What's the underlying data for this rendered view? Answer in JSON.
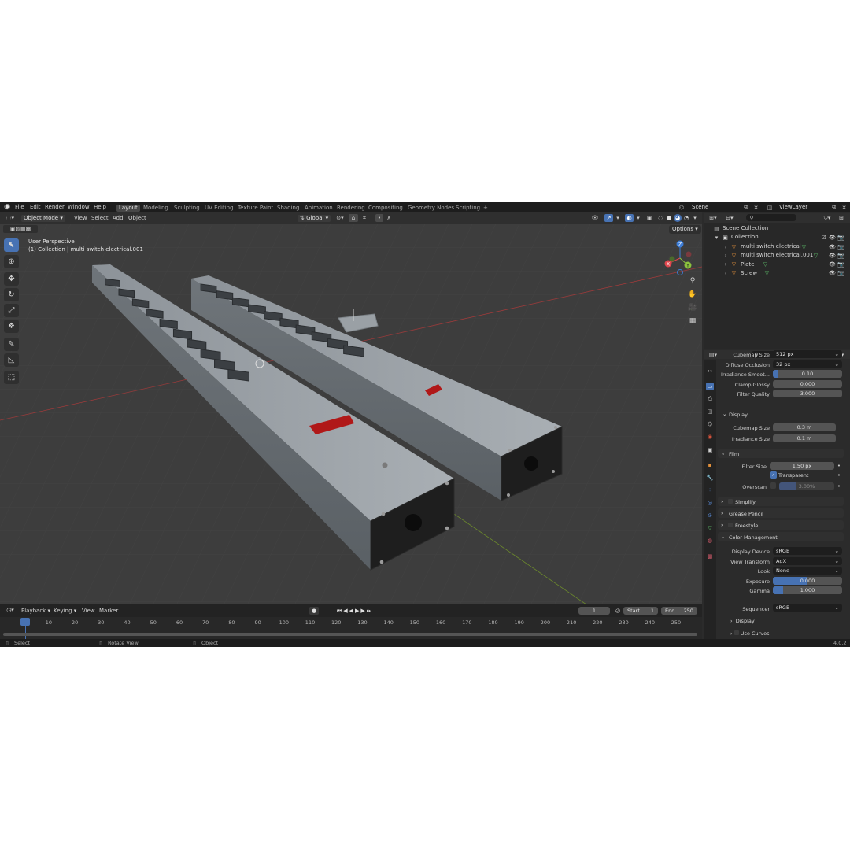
{
  "topbar": {
    "menus": [
      "File",
      "Edit",
      "Render",
      "Window",
      "Help"
    ],
    "workspaces": [
      "Layout",
      "Modeling",
      "Sculpting",
      "UV Editing",
      "Texture Paint",
      "Shading",
      "Animation",
      "Rendering",
      "Compositing",
      "Geometry Nodes",
      "Scripting"
    ],
    "add_tab": "+",
    "scene": "Scene",
    "view_layer": "ViewLayer"
  },
  "viewport_header": {
    "mode": "Object Mode",
    "menus": [
      "View",
      "Select",
      "Add",
      "Object"
    ],
    "orientation": "Global",
    "options": "Options"
  },
  "viewport": {
    "perspective": "User Perspective",
    "context": "(1) Collection | multi switch electrical.001",
    "gizmo": {
      "z": "Z",
      "x": "X",
      "y": "Y"
    }
  },
  "outliner": {
    "root": "Scene Collection",
    "collection": "Collection",
    "items": [
      "multi switch electrical",
      "multi switch electrical.001",
      "Plate",
      "Screw"
    ]
  },
  "properties": {
    "rows1": [
      {
        "label": "Cubemap Size",
        "value": "512 px"
      },
      {
        "label": "Diffuse Occlusion",
        "value": "32 px"
      },
      {
        "label": "Irradiance Smoot...",
        "value": "0.10"
      },
      {
        "label": "Clamp Glossy",
        "value": "0.000"
      },
      {
        "label": "Filter Quality",
        "value": "3.000"
      }
    ],
    "display_header": "Display",
    "display_rows": [
      {
        "label": "Cubemap Size",
        "value": "0.3 m"
      },
      {
        "label": "Irradiance Size",
        "value": "0.1 m"
      }
    ],
    "film_header": "Film",
    "film": {
      "filter_label": "Filter Size",
      "filter_value": "1.50 px",
      "transparent": "Transparent",
      "overscan_label": "Overscan",
      "overscan_value": "3.00%"
    },
    "simplify": "Simplify",
    "grease_pencil": "Grease Pencil",
    "freestyle": "Freestyle",
    "color_mgmt": "Color Management",
    "cm_rows": [
      {
        "label": "Display Device",
        "value": "sRGB"
      },
      {
        "label": "View Transform",
        "value": "AgX"
      },
      {
        "label": "Look",
        "value": "None"
      },
      {
        "label": "Exposure",
        "value": "0.000"
      },
      {
        "label": "Gamma",
        "value": "1.000"
      }
    ],
    "sequencer_label": "Sequencer",
    "sequencer_value": "sRGB",
    "display2": "Display",
    "use_curves": "Use Curves"
  },
  "timeline": {
    "menus": [
      "Playback",
      "Keying",
      "View",
      "Marker"
    ],
    "current_frame": "1",
    "start_label": "Start",
    "start": "1",
    "end_label": "End",
    "end": "250",
    "frames": [
      "1",
      "10",
      "20",
      "30",
      "40",
      "50",
      "60",
      "70",
      "80",
      "90",
      "100",
      "110",
      "120",
      "130",
      "140",
      "150",
      "160",
      "170",
      "180",
      "190",
      "200",
      "210",
      "220",
      "230",
      "240",
      "250"
    ]
  },
  "statusbar": {
    "select": "Select",
    "rotate": "Rotate View",
    "object": "Object",
    "version": "4.0.2"
  },
  "colors": {
    "accent": "#4772b3",
    "x_axis": "#e0474e",
    "y_axis": "#8bc33e",
    "z_axis": "#3d7dd6"
  }
}
